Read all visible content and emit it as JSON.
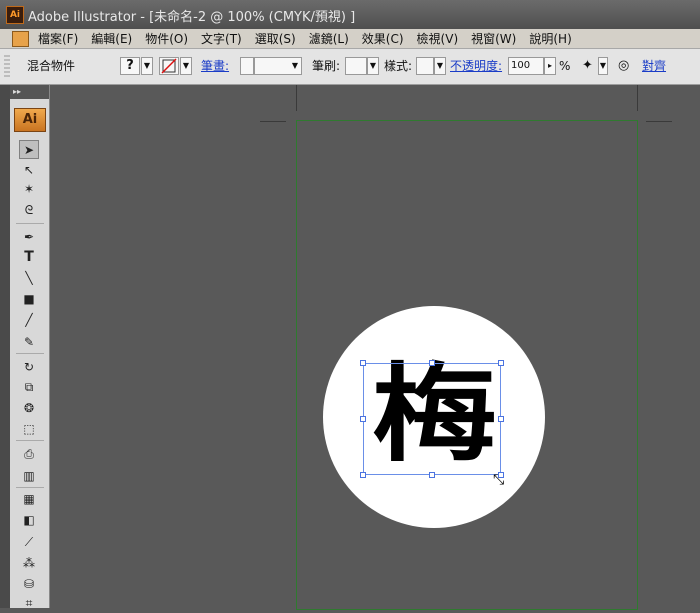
{
  "window": {
    "title": "Adobe Illustrator - [未命名-2 @ 100% (CMYK/預視) ]",
    "app_icon": "Ai"
  },
  "menu": {
    "items": [
      "檔案(F)",
      "編輯(E)",
      "物件(O)",
      "文字(T)",
      "選取(S)",
      "濾鏡(L)",
      "效果(C)",
      "檢視(V)",
      "視窗(W)",
      "說明(H)"
    ]
  },
  "control_bar": {
    "object_type": "混合物件",
    "fill_glyph": "?",
    "stroke_label": "筆畫:",
    "brush_label": "筆刷:",
    "style_label": "樣式:",
    "opacity_label": "不透明度:",
    "opacity_value": "100",
    "opacity_unit": "%",
    "align_label": "對齊"
  },
  "toolbox": {
    "collapse_glyph": "▸▸",
    "logo": "Ai",
    "type_tool_glyph": "T"
  },
  "canvas": {
    "character": "梅"
  },
  "icons": {
    "selection": "selection-arrow-icon",
    "direct_selection": "direct-selection-icon",
    "magic_wand": "magic-wand-icon",
    "lasso": "lasso-icon",
    "pen": "pen-icon",
    "type": "type-icon",
    "line": "line-segment-icon",
    "rectangle": "rectangle-icon",
    "paintbrush": "paintbrush-icon",
    "pencil": "pencil-icon",
    "rotate": "rotate-icon",
    "scale": "scale-icon",
    "warp": "warp-icon",
    "free_transform": "free-transform-icon",
    "symbol_sprayer": "symbol-sprayer-icon",
    "graph": "column-graph-icon",
    "mesh": "mesh-icon",
    "gradient": "gradient-icon",
    "eyedropper": "eyedropper-icon",
    "blend": "blend-icon",
    "live_paint": "live-paint-bucket-icon",
    "crop": "crop-area-icon"
  },
  "colors": {
    "accent": "#e7a24a",
    "selection": "#4b73e0",
    "artboard_border": "#2f7a2f"
  }
}
